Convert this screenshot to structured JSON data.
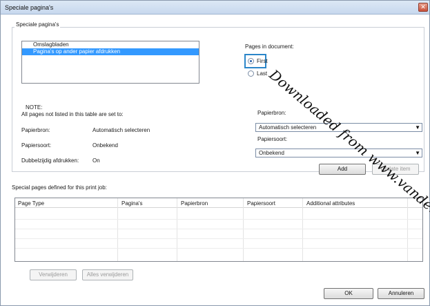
{
  "window": {
    "title": "Speciale pagina's"
  },
  "group": {
    "label": "Speciale pagina's"
  },
  "list": {
    "items": [
      {
        "label": "Omslagbladen",
        "selected": false
      },
      {
        "label": "Pagina's op ander papier afdrukken",
        "selected": true
      }
    ]
  },
  "pages_in_document": {
    "label": "Pages in document:",
    "options": [
      {
        "label": "First",
        "checked": true
      },
      {
        "label": "Last",
        "checked": false
      }
    ]
  },
  "note": {
    "heading": "NOTE:",
    "text": "All pages not listed in this table are set to:",
    "rows": [
      {
        "label": "Papierbron:",
        "value": "Automatisch selecteren"
      },
      {
        "label": "Papiersoort:",
        "value": "Onbekend"
      },
      {
        "label": "Dubbelzijdig afdrukken:",
        "value": "On"
      }
    ]
  },
  "right_panel": {
    "papierbron_label": "Papierbron:",
    "papierbron_value": "Automatisch selecteren",
    "papiersoort_label": "Papiersoort:",
    "papiersoort_value": "Onbekend",
    "add_label": "Add",
    "update_label": "Update item"
  },
  "special_pages": {
    "label": "Special pages defined for this print job:",
    "columns": [
      "Page Type",
      "Pagina's",
      "Papierbron",
      "Papiersoort",
      "Additional attributes"
    ]
  },
  "bottom": {
    "remove_label": "Verwijderen",
    "remove_all_label": "Alles verwijderen",
    "ok_label": "OK",
    "cancel_label": "Annuleren"
  },
  "watermark": {
    "text": "Downloaded from www.vandenborre.be"
  },
  "icons": {
    "close": "close-icon",
    "dropdown": "chevron-down-icon"
  }
}
